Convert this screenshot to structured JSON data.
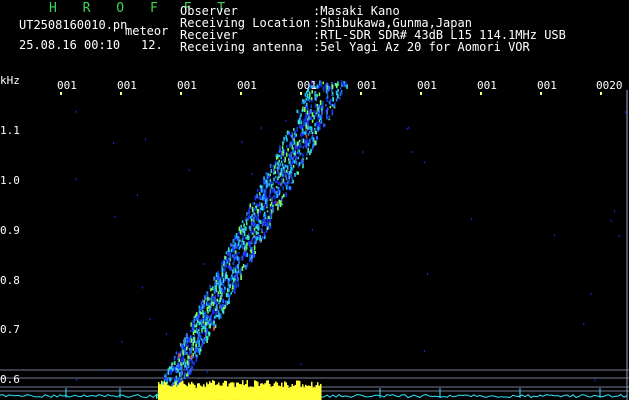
{
  "header": {
    "title": "H R O F F T",
    "filename": "UT2508160010.pn",
    "mode": "meteor",
    "datetime": "25.08.16 00:10",
    "count": "12.",
    "fields": [
      {
        "label": "Observer",
        "value": ":Masaki Kano"
      },
      {
        "label": "Receiving Location",
        "value": ":Shibukawa,Gunma,Japan"
      },
      {
        "label": "Receiver",
        "value": ":RTL-SDR SDR# 43dB L15 114.1MHz USB"
      },
      {
        "label": "Receiving antenna",
        "value": ":5el Yagi Az 20 for Aomori VOR"
      }
    ]
  },
  "axes": {
    "y_unit": "kHz",
    "y_ticks": [
      "1.1",
      "1.0",
      "0.9",
      "0.8",
      "0.7",
      "0.6"
    ],
    "x_ticks": [
      "001",
      "001",
      "001",
      "001",
      "001",
      "001",
      "001",
      "001",
      "001",
      "0020"
    ]
  },
  "colors": {
    "background": "#000000",
    "title": "#3bd35b",
    "text": "#ffffff",
    "tick_marks": "#ffff66",
    "signal_strong": "#ffff33",
    "baseline": "#33e6ff"
  }
}
